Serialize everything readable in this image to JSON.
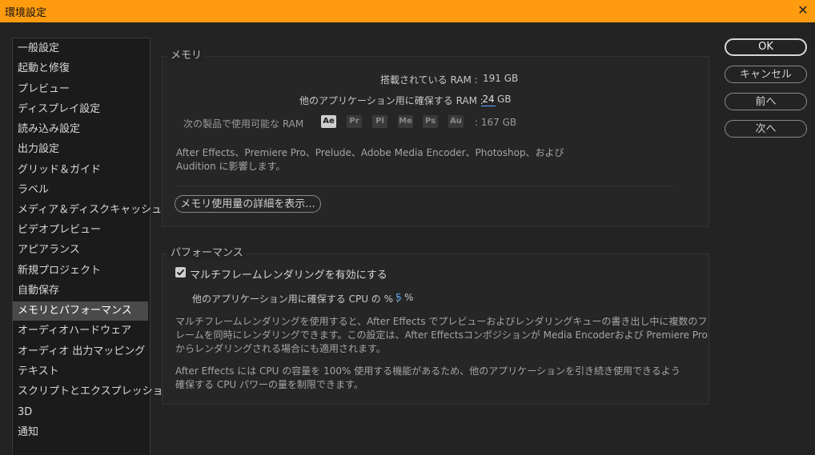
{
  "window": {
    "title": "環境設定",
    "close": "✕"
  },
  "sidebar": {
    "items": [
      "一般設定",
      "起動と修復",
      "プレビュー",
      "ディスプレイ設定",
      "読み込み設定",
      "出力設定",
      "グリッド＆ガイド",
      "ラベル",
      "メディア＆ディスクキャッシュ",
      "ビデオプレビュー",
      "アピアランス",
      "新規プロジェクト",
      "自動保存",
      "メモリとパフォーマンス",
      "オーディオハードウェア",
      "オーディオ 出力マッピング",
      "テキスト",
      "スクリプトとエクスプレッション",
      "3D",
      "通知"
    ],
    "selected_index": 13
  },
  "memory": {
    "group_label": "メモリ",
    "installed_label": "搭載されている RAM :",
    "installed_value": "191 GB",
    "reserved_label": "他のアプリケーション用に確保する RAM :",
    "reserved_value": "24",
    "reserved_unit": "GB",
    "available_label": "次の製品で使用可能な RAM",
    "apps": [
      "Ae",
      "Pr",
      "Pl",
      "Me",
      "Ps",
      "Au"
    ],
    "available_value": ": 167 GB",
    "note_line1": "After Effects、Premiere Pro、Prelude、Adobe Media Encoder、Photoshop、および",
    "note_line2": "Audition に影響します。",
    "details_button": "メモリ使用量の詳細を表示..."
  },
  "performance": {
    "group_label": "パフォーマンス",
    "mfr_checkbox_label": "マルチフレームレンダリングを有効にする",
    "mfr_checked": true,
    "cpu_label": "他のアプリケーション用に確保する CPU の % :",
    "cpu_value": "5",
    "cpu_unit": "%",
    "para1_line1": "マルチフレームレンダリングを使用すると、After Effects でプレビューおよびレンダリングキューの書き出し中に複数のフ",
    "para1_line2": "レームを同時にレンダリングできます。この設定は、After Effectsコンポジションが Media Encoderおよび Premiere Pro",
    "para1_line3": "からレンダリングされる場合にも適用されます。",
    "para2_line1": "After Effects には CPU の容量を 100% 使用する機能があるため、他のアプリケーションを引き続き使用できるよう",
    "para2_line2": "確保する CPU パワーの量を制限できます。"
  },
  "buttons": {
    "ok": "OK",
    "cancel": "キャンセル",
    "prev": "前へ",
    "next": "次へ"
  }
}
